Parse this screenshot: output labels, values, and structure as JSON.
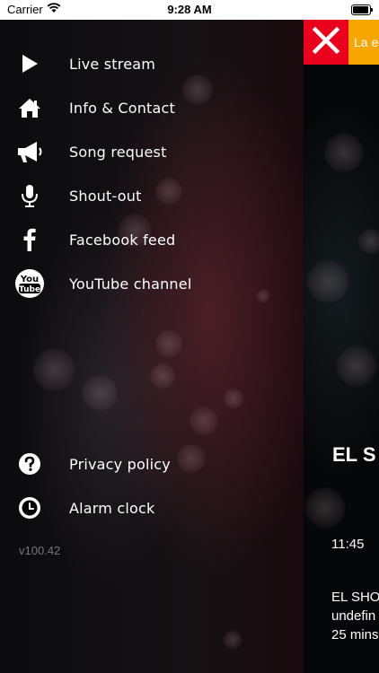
{
  "status_bar": {
    "carrier": "Carrier",
    "time": "9:28 AM"
  },
  "menu": {
    "items": [
      {
        "label": "Live stream",
        "icon": "play-icon"
      },
      {
        "label": "Info & Contact",
        "icon": "home-icon"
      },
      {
        "label": "Song request",
        "icon": "megaphone-icon"
      },
      {
        "label": "Shout-out",
        "icon": "microphone-icon"
      },
      {
        "label": "Facebook feed",
        "icon": "facebook-icon"
      },
      {
        "label": "YouTube channel",
        "icon": "youtube-icon",
        "icon_text": [
          "You",
          "Tube"
        ]
      },
      {
        "label": "Privacy policy",
        "icon": "question-icon"
      },
      {
        "label": "Alarm clock",
        "icon": "clock-icon"
      }
    ],
    "version": "v100.42"
  },
  "content": {
    "ticker_text": "La e",
    "show_title": "EL S",
    "show_time": "11:45",
    "show_lines": [
      "EL SHO",
      "undefin",
      "25 mins"
    ]
  },
  "colors": {
    "close_red": "#e8001c",
    "ticker_orange": "#f7a600",
    "version_gray": "#777777"
  }
}
